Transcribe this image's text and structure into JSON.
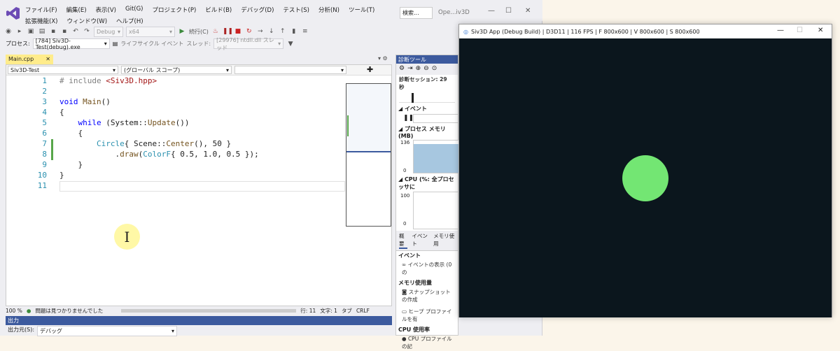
{
  "vs": {
    "menu": [
      "ファイル(F)",
      "編集(E)",
      "表示(V)",
      "Git(G)",
      "プロジェクト(P)",
      "ビルド(B)",
      "デバッグ(D)",
      "テスト(S)",
      "分析(N)",
      "ツール(T)",
      "拡張機能(X)",
      "ウィンドウ(W)",
      "ヘルプ(H)"
    ],
    "search_placeholder": "検索...",
    "window_title": "Ope...iv3D",
    "config": "Debug",
    "platform": "x64",
    "continue_label": "続行(C)",
    "process_label": "プロセス:",
    "process_value": "[784] Siv3D-Test(debug).exe",
    "lifecycle_label": "ライフサイクル イベント",
    "thread_label": "スレッド:",
    "thread_value": "[29976] ntdll.dll スレッド",
    "doc_tab": "Main.cpp",
    "nav_project": "Siv3D-Test",
    "nav_scope": "(グローバル スコープ)",
    "line_numbers": [
      "1",
      "2",
      "3",
      "4",
      "5",
      "6",
      "7",
      "8",
      "9",
      "10",
      "11"
    ],
    "code": {
      "l1a": "# include ",
      "l1b": "<Siv3D.hpp>",
      "l3a": "void ",
      "l3b": "Main",
      "l3c": "()",
      "l4": "{",
      "l5a": "    while ",
      "l5b": "(System::",
      "l5c": "Update",
      "l5d": "())",
      "l6": "    {",
      "l7a": "        ",
      "l7b": "Circle",
      "l7c": "{ Scene::",
      "l7d": "Center",
      "l7e": "(), 50 }",
      "l8a": "            .",
      "l8b": "draw",
      "l8c": "(",
      "l8d": "ColorF",
      "l8e": "{ 0.5, 1.0, 0.5 });",
      "l9": "    }",
      "l10": "}"
    },
    "status": {
      "zoom": "100 %",
      "issues": "問題は見つかりませんでした",
      "line": "行: 11",
      "char": "文字: 1",
      "tab": "タブ",
      "eol": "CRLF"
    },
    "output": {
      "title": "出力",
      "source_label": "出力元(S):",
      "source_value": "デバッグ"
    }
  },
  "diag": {
    "title": "診断ツール",
    "session": "診断セッション: 29 秒",
    "events": "イベント",
    "process_memory": "プロセス メモリ (MB)",
    "mem_max": "136",
    "mem_min": "0",
    "cpu": "CPU (%: 全プロセッサに",
    "cpu_max": "100",
    "cpu_min": "0",
    "tabs": [
      "概要",
      "イベント",
      "メモリ使用"
    ],
    "sec_event": "イベント",
    "show_events": "イベントの表示 (0 の",
    "sec_memory": "メモリ使用量",
    "snapshot": "スナップショットの作成",
    "heap": "ヒープ プロファイルを有",
    "sec_cpu": "CPU 使用率",
    "cpu_profile": "CPU プロファイルの記"
  },
  "siv": {
    "title": "Siv3D App (Debug Build) | D3D11 | 116 FPS | F 800x600 | V 800x600 | S 800x600"
  },
  "colors": {
    "accent": "#3c5a9e",
    "circle": "#73e673",
    "canvas": "#0b161d"
  }
}
